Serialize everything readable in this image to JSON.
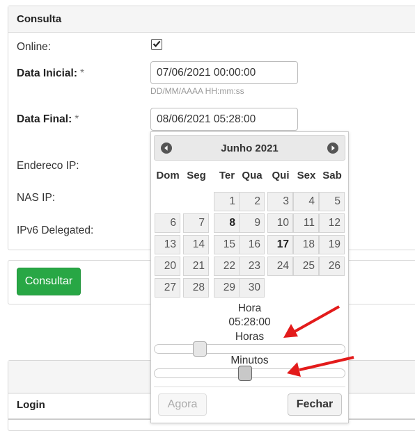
{
  "form_panel": {
    "title": "Consulta",
    "online_label": "Online:",
    "online_checked": true,
    "data_inicial_label": "Data Inicial:",
    "data_inicial_value": "07/06/2021 00:00:00",
    "data_inicial_help": "DD/MM/AAAA HH:mm:ss",
    "data_final_label": "Data Final:",
    "data_final_value": "08/06/2021 05:28:00",
    "required_mark": "*",
    "endereco_ip_label": "Endereco IP:",
    "nas_ip_label": "NAS IP:",
    "ipv6_label": "IPv6 Delegated:"
  },
  "actions": {
    "consultar_label": "Consultar"
  },
  "results_table": {
    "column_login": "Login"
  },
  "calendar": {
    "month_title": "Junho 2021",
    "weekdays": [
      "Dom",
      "Seg",
      "Ter",
      "Qua",
      "Qui",
      "Sex",
      "Sab"
    ],
    "first_weekday_index": 2,
    "days": [
      "1",
      "2",
      "3",
      "4",
      "5",
      "6",
      "7",
      "8",
      "9",
      "10",
      "11",
      "12",
      "13",
      "14",
      "15",
      "16",
      "17",
      "18",
      "19",
      "20",
      "21",
      "22",
      "23",
      "24",
      "25",
      "26",
      "27",
      "28",
      "29",
      "30"
    ],
    "bold_days": [
      "8",
      "17"
    ],
    "time_heading": "Hora",
    "time_value": "05:28:00",
    "hours_label": "Horas",
    "minutes_label": "Minutos",
    "hours_value": 5,
    "hours_max": 23,
    "minutes_value": 28,
    "minutes_max": 59,
    "now_label": "Agora",
    "close_label": "Fechar",
    "icons": {
      "prev": "circle-arrow-left-icon",
      "next": "circle-arrow-right-icon"
    },
    "annotation_arrow_color": "#e31b1b"
  }
}
